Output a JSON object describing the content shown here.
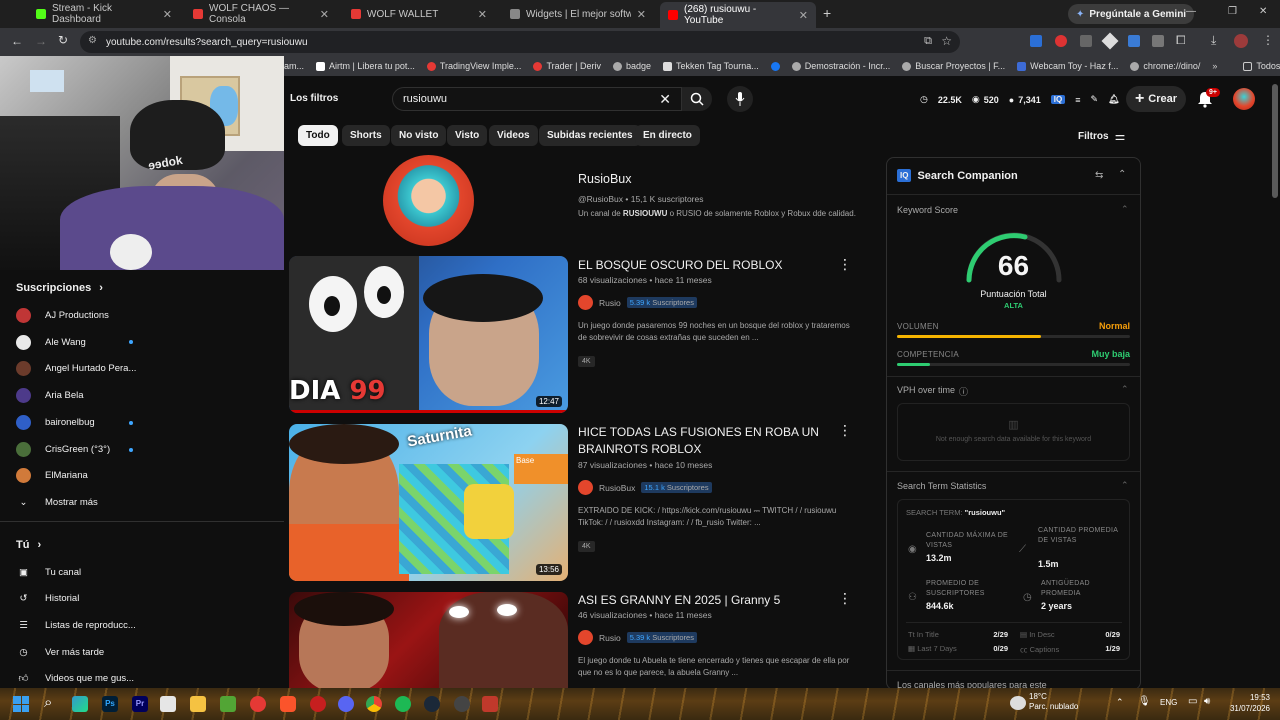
{
  "browser": {
    "tabs": [
      {
        "label": "Stream - Kick Dashboard",
        "color": "#53fc18"
      },
      {
        "label": "WOLF CHAOS — Consola",
        "color": "#e53935"
      },
      {
        "label": "WOLF WALLET",
        "color": "#e53935"
      },
      {
        "label": "Widgets | El mejor software pa",
        "color": "#888888"
      },
      {
        "label": "(268) rusiouwu - YouTube",
        "color": "#ff0000"
      }
    ],
    "gemini_label": "Pregúntale a Gemini",
    "url": "youtube.com/results?search_query=rusiouwu",
    "bookmarks": [
      "am...",
      "Airtm | Libera tu pot...",
      "TradingView Imple...",
      "Trader | Deriv",
      "badge",
      "Tekken Tag Tourna...",
      "Demostración - Incr...",
      "Buscar Proyectos | F...",
      "Webcam Toy - Haz f...",
      "chrome://dino/"
    ],
    "bookmarks_all": "Todos los favoritos"
  },
  "yt": {
    "filters_label": "Los filtros",
    "search_value": "rusiouwu",
    "stats": {
      "views": "22.5K",
      "watch": "520",
      "subs": "7,341"
    },
    "create_label": "Crear",
    "notif_count": "9+",
    "chips": [
      "Todo",
      "Shorts",
      "No visto",
      "Visto",
      "Videos",
      "Subidas recientes",
      "En directo"
    ],
    "filters_button": "Filtros",
    "sidebar": {
      "subscriptions_label": "Suscripciones",
      "subs": [
        "AJ Productions",
        "Ale Wang",
        "Angel Hurtado Pera...",
        "Aria Bela",
        "baironelbug",
        "CrisGreen (°3°)",
        "ElMariana"
      ],
      "show_more": "Mostrar más",
      "you_label": "Tú",
      "you_items": [
        "Tu canal",
        "Historial",
        "Listas de reproducc...",
        "Ver más tarde",
        "Videos que me gus..."
      ]
    },
    "channel": {
      "name": "RusioBux",
      "handle": "@RusioBux",
      "subscribers": "15,1 K suscriptores",
      "description_pre": "Un canal de ",
      "description_bold1": "RUSIOUWU",
      "description_mid": " o RUSIO de solamente Roblox y Robux dde calidad."
    },
    "videos": [
      {
        "title": "EL BOSQUE OSCURO DEL ROBLOX",
        "views": "68 visualizaciones",
        "age": "hace 11 meses",
        "channel": "Rusio",
        "subs_badge": "5.39 k",
        "subs_suffix": "Suscriptores",
        "description": "Un juego donde pasaremos 99 noches en un bosque del roblox y trataremos de sobrevivir de cosas extrañas que suceden en ...",
        "badge": "4K",
        "duration": "12:47",
        "thumb_text": "DIA 99"
      },
      {
        "title": "HICE TODAS LAS FUSIONES EN ROBA UN BRAINROTS ROBLOX",
        "views": "87 visualizaciones",
        "age": "hace 10 meses",
        "channel": "RusioBux",
        "subs_badge": "15.1 k",
        "subs_suffix": "Suscriptores",
        "description": "EXTRAIDO DE KICK: / https://kick.com/rusiouwu ⎓ TWITCH / / rusiouwu TikTok: / / rusioxdd Instagram: / / fb_rusio Twitter: ...",
        "badge": "4K",
        "duration": "13:56",
        "thumb_text": "Saturnita"
      },
      {
        "title": "ASI ES GRANNY EN 2025 | Granny 5",
        "views": "46 visualizaciones",
        "age": "hace 11 meses",
        "channel": "Rusio",
        "subs_badge": "5.39 k",
        "subs_suffix": "Suscriptores",
        "description": "El juego donde tu Abuela te tiene encerrado y tienes que escapar de ella por que no es lo que parece, la abuela Granny ...",
        "badge": "",
        "duration": "",
        "thumb_text": ""
      }
    ]
  },
  "companion": {
    "title": "Search Companion",
    "keyword_score_label": "Keyword Score",
    "score": "66",
    "score_label": "Puntuación Total",
    "score_level": "ALTA",
    "volume_label": "VOLUMEN",
    "volume_value": "Normal",
    "volume_fill": 0.62,
    "competition_label": "COMPETENCIA",
    "competition_value": "Muy baja",
    "competition_fill": 0.14,
    "vph_label": "VPH over time",
    "vph_empty": "Not enough search data available for this keyword",
    "sts_label": "Search Term Statistics",
    "search_term_label": "SEARCH TERM:",
    "search_term_value": "\"rusiouwu\"",
    "stats": [
      {
        "label": "CANTIDAD MÁXIMA DE VISTAS",
        "value": "13.2m"
      },
      {
        "label": "CANTIDAD PROMEDIA DE VISTAS",
        "value": "1.5m"
      },
      {
        "label": "PROMEDIO DE SUSCRIPTORES",
        "value": "844.6k"
      },
      {
        "label": "ANTIGÜEDAD PROMEDIA",
        "value": "2 years"
      }
    ],
    "in_title_label": "In Title",
    "in_title_value": "2/29",
    "in_desc_label": "In Desc",
    "in_desc_value": "0/29",
    "last7_label": "Last 7 Days",
    "last7_value": "0/29",
    "captions_label": "Captions",
    "captions_value": "1/29",
    "popular_label": "Los canales más populares para este",
    "colors": {
      "green": "#2ecc71",
      "amber": "#f5b400",
      "orange": "#f59e0b"
    }
  },
  "taskbar": {
    "weather_temp": "18°C",
    "weather_desc": "Parc. nublado",
    "lang": "ENG",
    "time": "19:53",
    "date": "31/07/2026"
  }
}
